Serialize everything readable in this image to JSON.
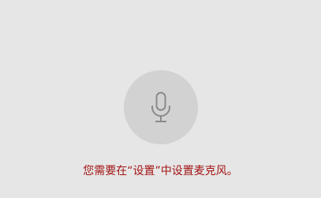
{
  "microphone": {
    "icon": "microphone-icon",
    "state": "disabled"
  },
  "message": {
    "text": "您需要在“设置”中设置麦克风。"
  },
  "colors": {
    "background": "#e6e6e6",
    "circle": "#d2d2d2",
    "icon": "#8a8a8a",
    "message": "#a31515"
  }
}
